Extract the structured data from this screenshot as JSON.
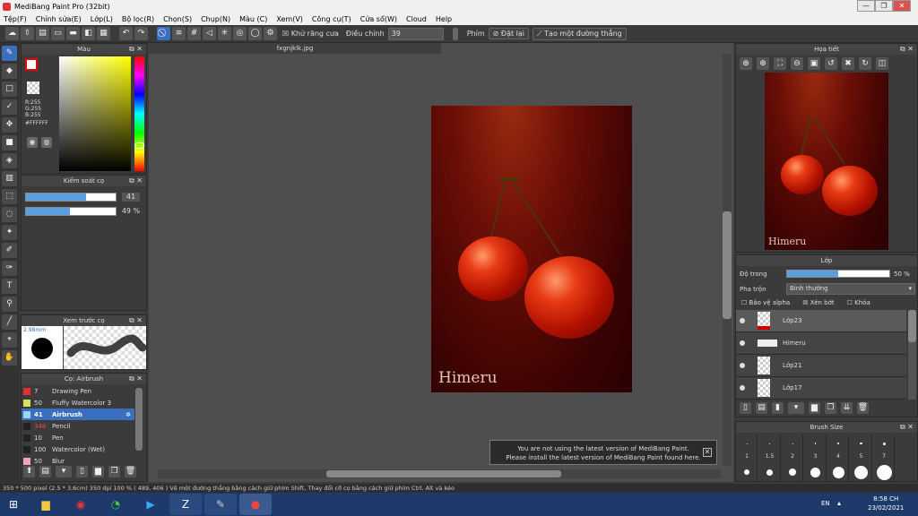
{
  "window": {
    "title": "MediBang Paint Pro (32bit)",
    "min": "—",
    "max": "❐",
    "close": "✕"
  },
  "menu": [
    "Tệp(F)",
    "Chỉnh sửa(E)",
    "Lớp(L)",
    "Bộ lọc(R)",
    "Chọn(S)",
    "Chụp(N)",
    "Màu (C)",
    "Xem(V)",
    "Công cụ(T)",
    "Cửa sổ(W)",
    "Cloud",
    "Help"
  ],
  "toolbar": {
    "antialias": "Khử răng cưa",
    "adjust_label": "Điều chỉnh",
    "adjust_value": "39",
    "key_label": "Phím",
    "reset": "Đặt lại",
    "line_btn": "Tạo một đường thẳng"
  },
  "color_panel": {
    "title": "Màu",
    "r": "R:255",
    "g": "G:255",
    "b": "B:255",
    "hex": "#FFFFFF"
  },
  "brush_control": {
    "title": "Kiểm soát cọ",
    "size": "41",
    "size_fill": 0.67,
    "opacity": "49 %",
    "opacity_fill": 0.49
  },
  "brush_preview": {
    "title": "Xem trước cọ",
    "size": "2.98mm"
  },
  "brush_list": {
    "title": "Cọ: Airbrush",
    "items": [
      {
        "size": "7",
        "name": "Drawing Pen",
        "color": "#e03030"
      },
      {
        "size": "50",
        "name": "Fluffy Watercolor 3",
        "color": "#d7e060"
      },
      {
        "size": "41",
        "name": "Airbrush",
        "color": "#9ad8f0",
        "selected": true
      },
      {
        "size": "348",
        "name": "Pencil",
        "color": "#222222"
      },
      {
        "size": "10",
        "name": "Pen",
        "color": "#222222"
      },
      {
        "size": "100",
        "name": "Watercolor (Wet)",
        "color": "#222222"
      },
      {
        "size": "50",
        "name": "Blur",
        "color": "#f0a0c0"
      }
    ]
  },
  "document": {
    "tab": "fxgnjklk.jpg",
    "signature": "Himeru"
  },
  "notification": {
    "line1": "You are not using the latest version of MediBang Paint.",
    "line2": "Please install the latest version of MediBang Paint found here."
  },
  "navigator": {
    "title": "Họa tiết"
  },
  "layers": {
    "title": "Lớp",
    "opacity_label": "Độ trong",
    "opacity_value": "50 %",
    "opacity_fill": 0.5,
    "blend_label": "Pha trộn",
    "blend_value": "Bình thường",
    "protect_alpha": "Bảo vệ alpha",
    "clip": "Xén bớt",
    "lock": "Khóa",
    "items": [
      "Lớp23",
      "Himeru",
      "Lớp21",
      "Lớp17"
    ]
  },
  "brush_size": {
    "title": "Brush Size",
    "labels": [
      "1",
      "1.5",
      "2",
      "3",
      "4",
      "5",
      "7"
    ]
  },
  "status": "350 * 500 pixel   (2.5 * 3.6cm)   350 dpi   100 %   ( 489, 406 )   Vẽ một đường thẳng bằng cách giữ phím Shift, Thay đổi cỡ cọ bằng cách giữ phím Ctrl, Alt và kéo",
  "taskbar": {
    "lang": "EN",
    "time": "8:58 CH",
    "date": "23/02/2021"
  }
}
